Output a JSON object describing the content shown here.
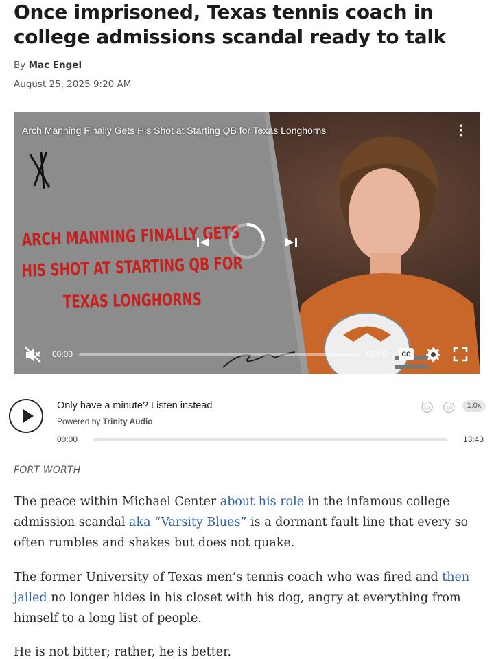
{
  "article": {
    "headline": "Once imprisoned, Texas tennis coach in college admissions scandal ready to talk",
    "byline_prefix": "By",
    "author": "Mac Engel",
    "date": "August 25, 2025 9:20 AM",
    "location": "FORT WORTH"
  },
  "video": {
    "title": "Arch Manning Finally Gets His Shot at Starting QB for Texas Longhorns",
    "thumbnail_text": [
      "ARCH MANNING FINALLY GETS",
      "HIS SHOT AT STARTING QB FOR",
      "TEXAS LONGHORNS"
    ],
    "time_current": "00:00",
    "time_duration": "00:00",
    "cc_label": "CC",
    "progress": 0
  },
  "audio": {
    "prompt": "Only have a minute? Listen instead",
    "powered_prefix": "Powered by",
    "powered_brand": "Trinity Audio",
    "time_current": "00:00",
    "time_duration": "13:43",
    "speed": "1.0x",
    "rewind_label": "10",
    "forward_label": "10",
    "progress": 0
  },
  "body": {
    "p1": {
      "t1": "The peace within Michael Center ",
      "link1": "about his role",
      "t2": " in the infamous college admission scandal ",
      "link2": "aka “Varsity Blues”",
      "t3": " is a dormant fault line that every so often rumbles and shakes but does not quake."
    },
    "p2": {
      "t1": "The former University of Texas men’s tennis coach who was fired and ",
      "link1": "then jailed",
      "t2": " no longer hides in his closet with his dog, angry at everything from himself to a long list of people."
    },
    "p3": "He is not bitter; rather, he is better."
  },
  "colors": {
    "link": "#2b5fa8",
    "thumb_red": "#c8201e",
    "shirt_orange": "#c9672a"
  }
}
